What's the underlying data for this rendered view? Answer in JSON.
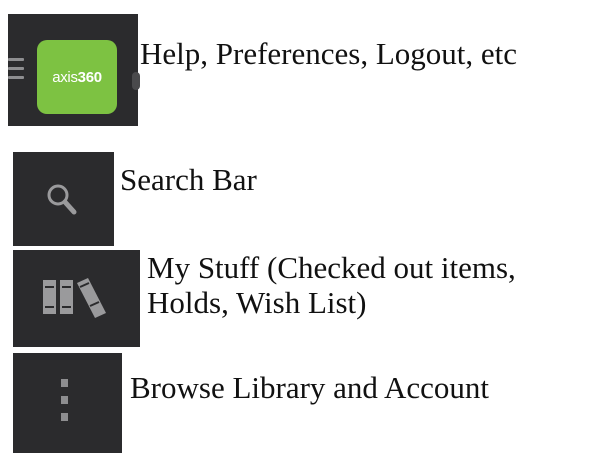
{
  "items": [
    {
      "id": "menu",
      "logo_text_light": "axis",
      "logo_text_bold": "360",
      "icon": "hamburger-menu-icon",
      "caption_lines": [
        "Help, Preferences, Logout, etc"
      ]
    },
    {
      "id": "search",
      "icon": "search-icon",
      "caption_lines": [
        "Search Bar"
      ]
    },
    {
      "id": "my-stuff",
      "icon": "books-icon",
      "caption_lines": [
        "My Stuff (Checked out items,",
        "Holds, Wish List)"
      ]
    },
    {
      "id": "browse",
      "icon": "more-vertical-icon",
      "caption_lines": [
        "Browse Library and Account"
      ]
    }
  ],
  "colors": {
    "tile_background": "#2b2b2d",
    "brand_green": "#7dc242",
    "icon_gray": "#9a9a9c"
  }
}
